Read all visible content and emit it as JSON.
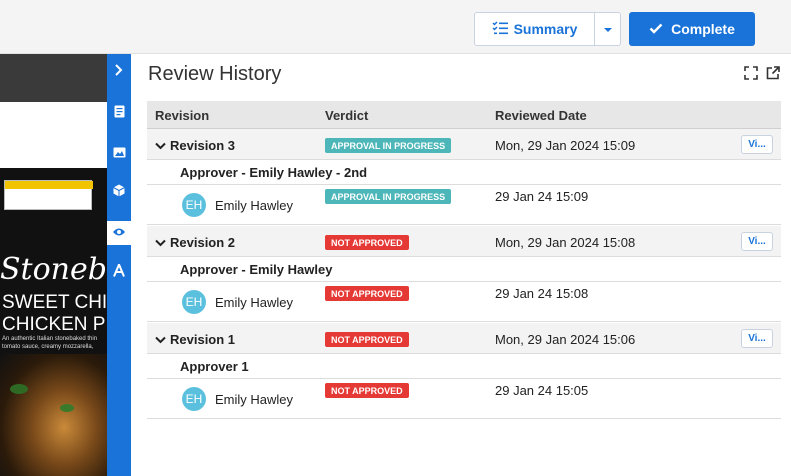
{
  "toolbar": {
    "summary_label": "Summary",
    "complete_label": "Complete"
  },
  "preview": {
    "brand": "Stonebaked",
    "product_line1": "SWEET CHI",
    "product_line2": "CHICKEN PI",
    "desc_line1": "An authentic Italian stonebaked thin",
    "desc_line2": "tomato sauce, creamy mozzarella,"
  },
  "panel": {
    "title": "Review History",
    "columns": [
      "Revision",
      "Verdict",
      "Reviewed Date"
    ],
    "revisions": [
      {
        "name": "Revision 3",
        "verdict": "APPROVAL IN PROGRESS",
        "date": "Mon, 29 Jan 2024 15:09",
        "view_label": "Vi...",
        "approver": "Approver - Emily Hawley - 2nd",
        "user": {
          "initials": "EH",
          "name": "Emily Hawley",
          "verdict": "APPROVAL IN PROGRESS",
          "date": "29 Jan 24 15:09"
        }
      },
      {
        "name": "Revision 2",
        "verdict": "NOT APPROVED",
        "date": "Mon, 29 Jan 2024 15:08",
        "view_label": "Vi...",
        "approver": "Approver - Emily Hawley",
        "user": {
          "initials": "EH",
          "name": "Emily Hawley",
          "verdict": "NOT APPROVED",
          "date": "29 Jan 24 15:08"
        }
      },
      {
        "name": "Revision 1",
        "verdict": "NOT APPROVED",
        "date": "Mon, 29 Jan 2024 15:06",
        "view_label": "Vi...",
        "approver": "Approver 1",
        "user": {
          "initials": "EH",
          "name": "Emily Hawley",
          "verdict": "NOT APPROVED",
          "date": "29 Jan 24 15:05"
        }
      }
    ]
  },
  "colors": {
    "accent": "#1a73d9",
    "in_progress": "#4cb6b9",
    "not_approved": "#e53935",
    "avatar": "#5bc0de"
  },
  "icons": {
    "side_tools": [
      "chevron-right-icon",
      "document-icon",
      "image-icon",
      "cube-icon",
      "eye-icon",
      "text-icon"
    ]
  }
}
